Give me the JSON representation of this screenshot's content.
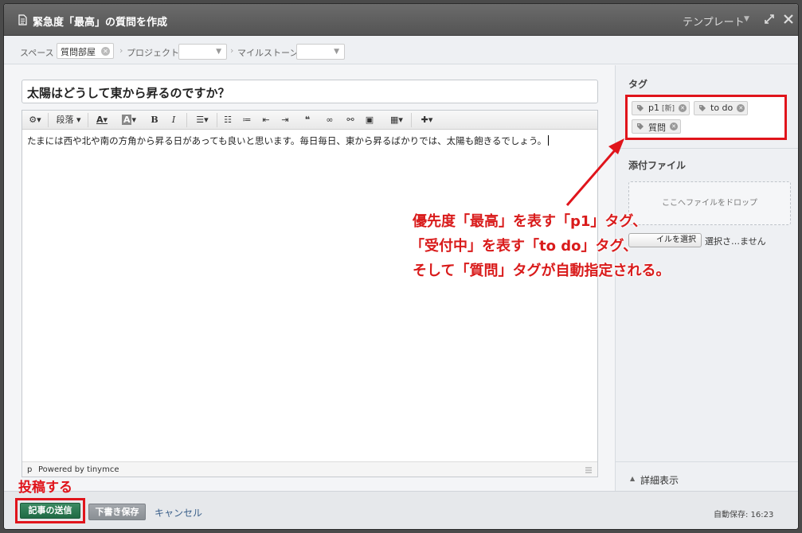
{
  "window": {
    "title": "緊急度「最高」の質問を作成",
    "template_label": "テンプレート"
  },
  "meta": {
    "space_label": "スペース",
    "space_value": "質問部屋",
    "project_label": "プロジェクト",
    "milestone_label": "マイルストーン"
  },
  "editor": {
    "title_value": "太陽はどうして東から昇るのですか？",
    "body": "たまには西や北や南の方角から昇る日があっても良いと思います。毎日毎日、東から昇るばかりでは、太陽も飽きるでしょう。",
    "toolbar": {
      "paragraph_label": "段落",
      "bold": "B",
      "italic": "I"
    },
    "status_path": "p",
    "powered_by": "Powered by tinymce"
  },
  "sidebar": {
    "tags_heading": "タグ",
    "tags": [
      {
        "label": "p1",
        "badge": "[新]"
      },
      {
        "label": "to do",
        "badge": ""
      },
      {
        "label": "質問",
        "badge": ""
      }
    ],
    "attachments_heading": "添付ファイル",
    "dropzone_text": "ここへファイルをドロップ",
    "file_button": "イルを選択",
    "file_status": "選択さ…ません",
    "details_label": "詳細表示"
  },
  "footer": {
    "submit_label": "記事の送信",
    "draft_label": "下書き保存",
    "cancel_label": "キャンセル",
    "autosave": "自動保存: 16:23"
  },
  "annotations": {
    "post_label": "投稿する",
    "callout_lines": [
      "優先度「最高」を表す「p1」タグ、",
      "「受付中」を表す「to do」タグ、",
      "そして「質問」タグが自動指定される。"
    ],
    "accent_color": "#e0141b"
  }
}
